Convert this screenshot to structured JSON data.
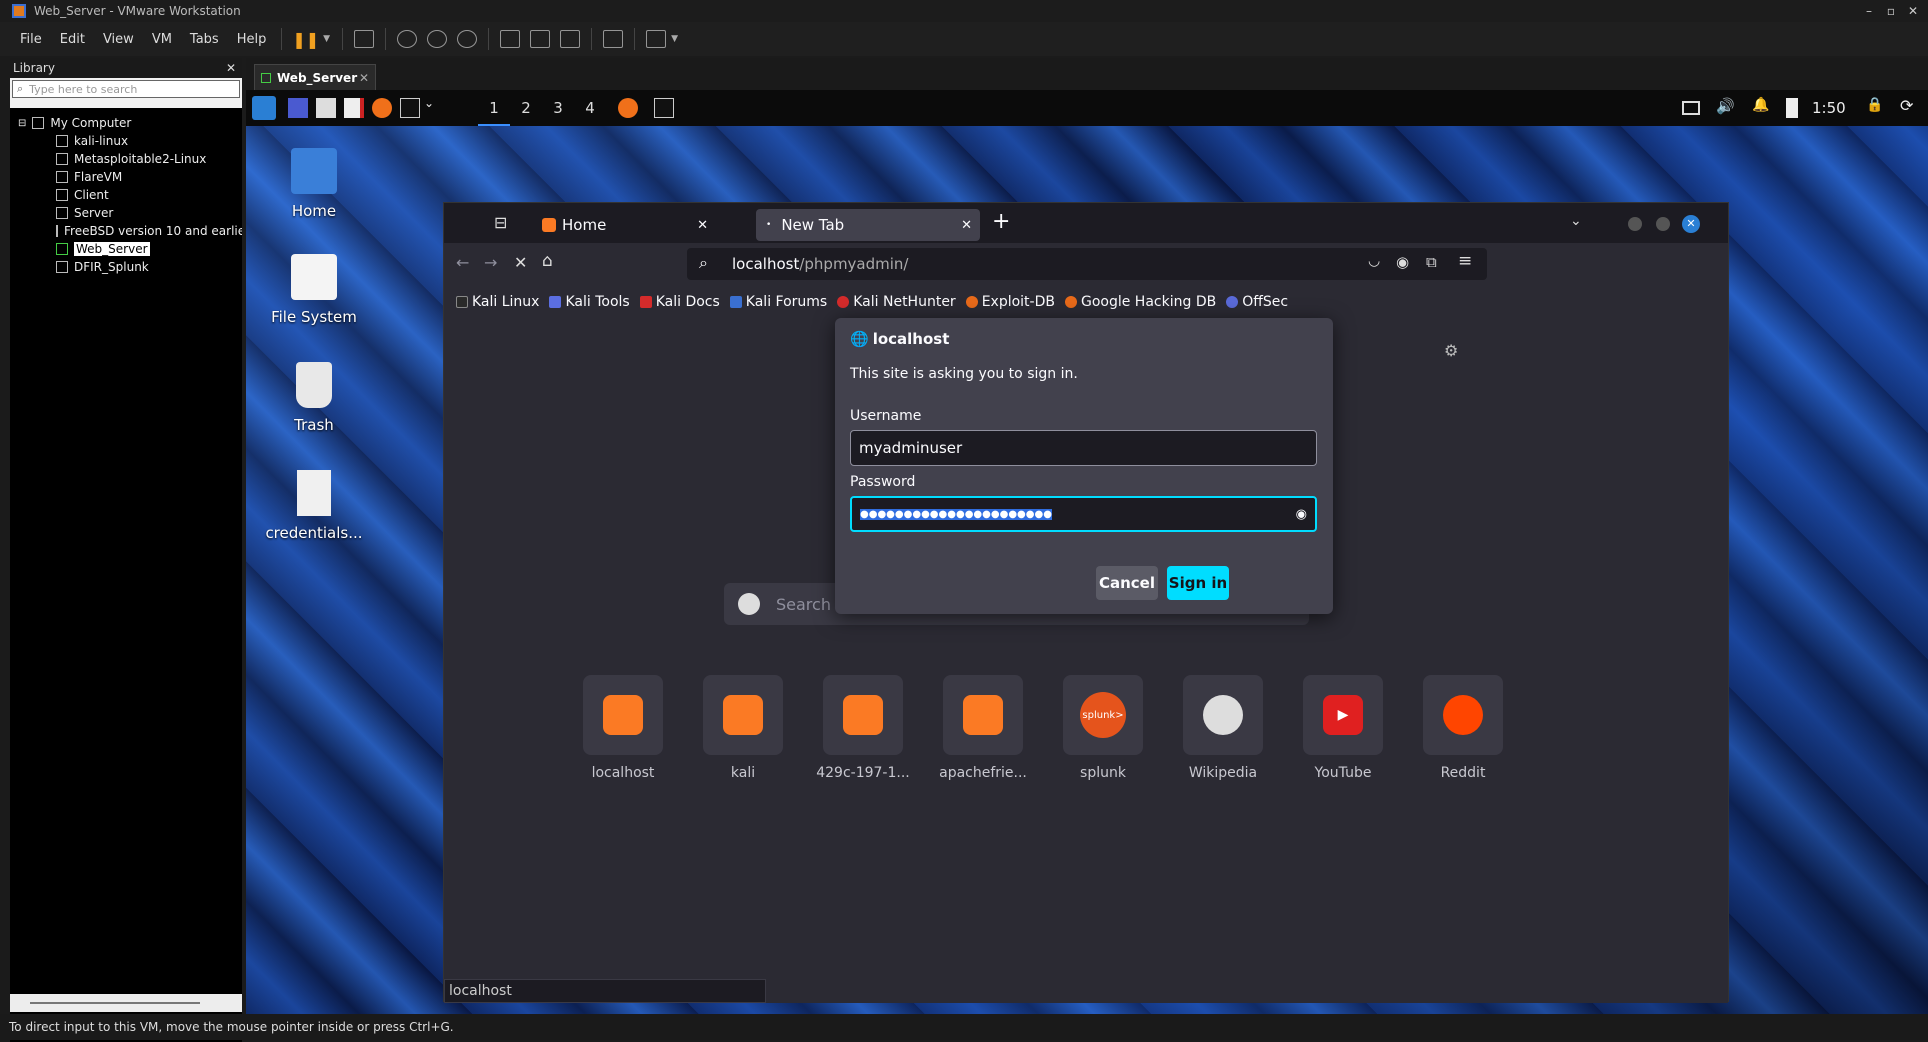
{
  "vmware": {
    "title": "Web_Server - VMware Workstation",
    "menu": [
      "File",
      "Edit",
      "View",
      "VM",
      "Tabs",
      "Help"
    ],
    "library": {
      "title": "Library",
      "search_placeholder": "Type here to search",
      "root": "My Computer",
      "items": [
        "kali-linux",
        "Metasploitable2-Linux",
        "FlareVM",
        "Client",
        "Server",
        "FreeBSD version 10 and earlier",
        "Web_Server",
        "DFIR_Splunk"
      ],
      "selected": "Web_Server"
    },
    "vm_tab": "Web_Server",
    "status": "To direct input to this VM, move the mouse pointer inside or press Ctrl+G."
  },
  "guest": {
    "panel": {
      "workspaces": [
        "1",
        "2",
        "3",
        "4"
      ],
      "clock": "1:50"
    },
    "desktop_icons": [
      "Home",
      "File System",
      "Trash",
      "credentials..."
    ]
  },
  "firefox": {
    "tabs": [
      {
        "label": "Home",
        "active": false
      },
      {
        "label": "New Tab",
        "active": true
      }
    ],
    "url_host": "localhost",
    "url_path": "/phpmyadmin/",
    "bookmarks": [
      "Kali Linux",
      "Kali Tools",
      "Kali Docs",
      "Kali Forums",
      "Kali NetHunter",
      "Exploit-DB",
      "Google Hacking DB",
      "OffSec"
    ],
    "search_placeholder": "Search",
    "tiles": [
      "localhost",
      "kali",
      "429c-197-1...",
      "apachefrie...",
      "splunk",
      "Wikipedia",
      "YouTube",
      "Reddit"
    ],
    "splunk_logo": "splunk>",
    "status_url": "localhost"
  },
  "auth_dialog": {
    "host": "localhost",
    "message": "This site is asking you to sign in.",
    "username_label": "Username",
    "username_value": "myadminuser",
    "password_label": "Password",
    "password_mask": "●●●●●●●●●●●●●●●●●●●●●●",
    "cancel_label": "Cancel",
    "signin_label": "Sign in",
    "accent": "#00ddff"
  }
}
